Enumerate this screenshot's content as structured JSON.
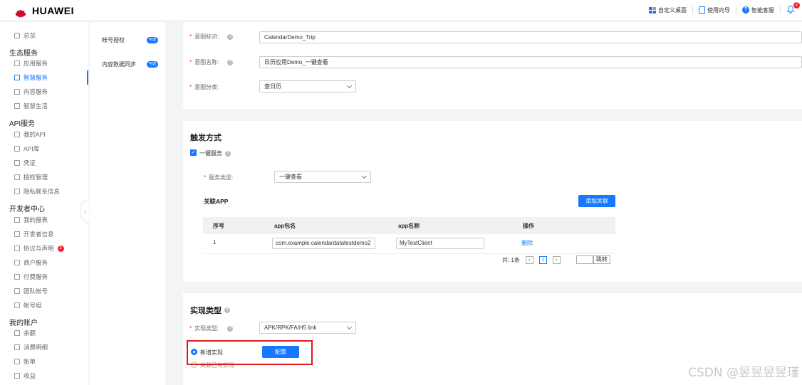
{
  "header": {
    "logo_text": "HUAWEI",
    "custom_desktop": "自定义桌面",
    "usage_guide": "使用向导",
    "smart_support": "智能客服",
    "notification_count": "2"
  },
  "sidebar": {
    "overview": "总览",
    "group_eco": "生态服务",
    "app_service": "应用服务",
    "smart_service": "智慧服务",
    "content_service": "内容服务",
    "smart_life": "智慧生活",
    "group_api": "API服务",
    "my_api": "我的API",
    "api_lib": "API库",
    "credential": "凭证",
    "auth_mgmt": "授权管理",
    "privacy_contact": "隐私联系信息",
    "group_dev": "开发者中心",
    "my_report": "我的报表",
    "dev_info": "开发者信息",
    "agreement": "协议与声明",
    "agreement_badge": "2",
    "merchant_service": "商户服务",
    "paid_service": "付费服务",
    "team_account": "团队帐号",
    "account_group": "帐号组",
    "group_account": "我的账户",
    "balance": "余额",
    "consumption": "消费明细",
    "bill": "账单",
    "income": "收益"
  },
  "subnav": {
    "account_auth": "帐号授权",
    "content_sync": "内容数据同步",
    "tag": "可选"
  },
  "intent": {
    "id_label": "意图标识:",
    "id_value": "CalendarDemo_Trip",
    "name_label": "意图名称:",
    "name_value": "日历应用Demo_一键查看",
    "category_label": "意图分类:",
    "category_value": "查日历"
  },
  "trigger": {
    "title": "触发方式",
    "one_click_label": "一键服务",
    "service_type_label": "服务类型:",
    "service_type_value": "一键查看",
    "related_app_title": "关联APP",
    "add_link_button": "添加关联",
    "columns": [
      "序号",
      "app包名",
      "app名称",
      "操作"
    ],
    "rows": [
      {
        "index": "1",
        "package": "com.example.calendardatatestdemo2",
        "app_name": "MyTestClient",
        "action": "删除"
      }
    ],
    "pager_total": "共: 1条",
    "pager_page": "1",
    "pager_jump": "跳转"
  },
  "implementation": {
    "title": "实现类型",
    "type_label": "实现类型:",
    "type_value": "APK/RPK/FA/H5 link",
    "option_new": "新增实现",
    "option_existing": "关联已有实现",
    "config_button": "配置"
  },
  "watermark": "CSDN @昱昱昱昱瑾"
}
